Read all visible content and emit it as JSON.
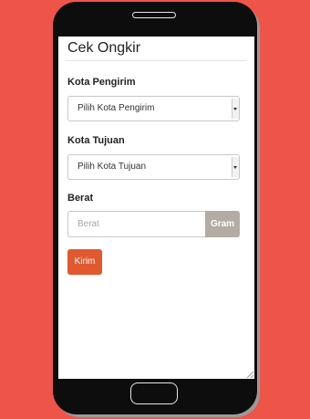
{
  "page": {
    "title": "Cek Ongkir"
  },
  "form": {
    "origin": {
      "label": "Kota Pengirim",
      "selected": "Pilih Kota Pengirim"
    },
    "destination": {
      "label": "Kota Tujuan",
      "selected": "Pilih Kota Tujuan"
    },
    "weight": {
      "label": "Berat",
      "placeholder": "Berat",
      "unit": "Gram"
    },
    "submit_label": "Kirim"
  },
  "colors": {
    "background": "#ef5448",
    "submit_button": "#e2582f",
    "unit_addon": "#b3aca4"
  }
}
